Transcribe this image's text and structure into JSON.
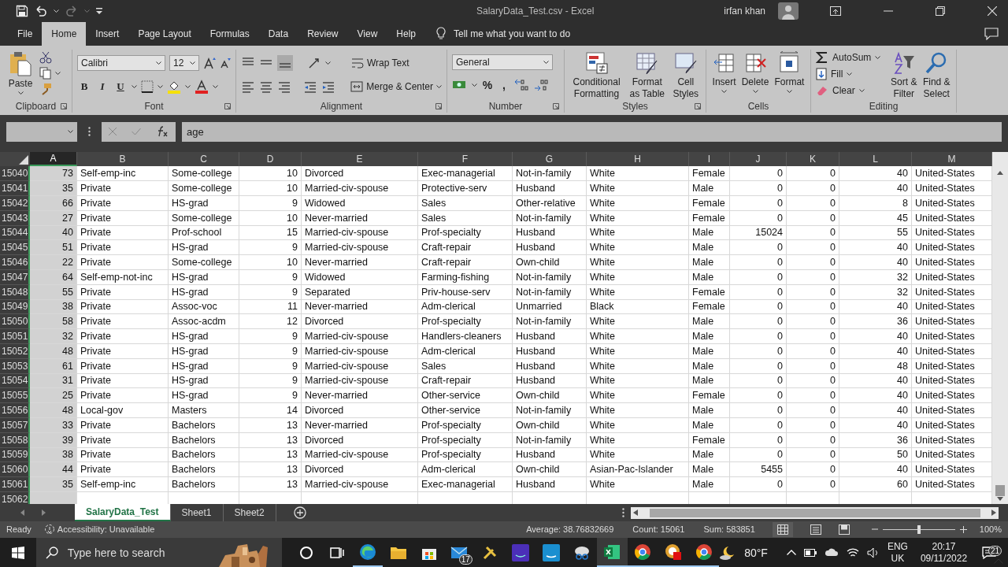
{
  "title_bar": {
    "title": "SalaryData_Test.csv  -  Excel",
    "user": "irfan khan",
    "redo": {
      "disabled": true
    }
  },
  "menu_tabs": [
    {
      "label": "File",
      "selected": false
    },
    {
      "label": "Home",
      "selected": true
    },
    {
      "label": "Insert",
      "selected": false
    },
    {
      "label": "Page Layout",
      "selected": false
    },
    {
      "label": "Formulas",
      "selected": false
    },
    {
      "label": "Data",
      "selected": false
    },
    {
      "label": "Review",
      "selected": false
    },
    {
      "label": "View",
      "selected": false
    },
    {
      "label": "Help",
      "selected": false
    }
  ],
  "tell_me": "Tell me what you want to do",
  "ribbon": {
    "clipboard": {
      "label": "Clipboard",
      "paste": "Paste"
    },
    "font": {
      "label": "Font",
      "name": "Calibri",
      "size": "12",
      "styles": [
        "B",
        "I",
        "U"
      ]
    },
    "alignment": {
      "label": "Alignment",
      "wrap": "Wrap Text",
      "merge": "Merge & Center"
    },
    "number": {
      "label": "Number",
      "format": "General",
      "symbols": [
        "%",
        ","
      ]
    },
    "styles": {
      "label": "Styles",
      "buttons": [
        "Conditional Formatting",
        "Format as Table",
        "Cell Styles"
      ]
    },
    "cells": {
      "label": "Cells",
      "buttons": [
        "Insert",
        "Delete",
        "Format"
      ]
    },
    "editing": {
      "label": "Editing",
      "small": [
        "AutoSum",
        "Fill",
        "Clear"
      ],
      "buttons": [
        "Sort & Filter",
        "Find & Select"
      ]
    }
  },
  "formula_bar": {
    "formula": "age"
  },
  "columns": [
    {
      "label": "A",
      "kind": "numeric",
      "selected": true
    },
    {
      "label": "B",
      "kind": "text",
      "selected": false
    },
    {
      "label": "C",
      "kind": "text",
      "selected": false
    },
    {
      "label": "D",
      "kind": "numeric",
      "selected": false
    },
    {
      "label": "E",
      "kind": "text",
      "selected": false
    },
    {
      "label": "F",
      "kind": "text",
      "selected": false
    },
    {
      "label": "G",
      "kind": "text",
      "selected": false
    },
    {
      "label": "H",
      "kind": "text",
      "selected": false
    },
    {
      "label": "I",
      "kind": "text",
      "selected": false
    },
    {
      "label": "J",
      "kind": "numeric",
      "selected": false
    },
    {
      "label": "K",
      "kind": "numeric",
      "selected": false
    },
    {
      "label": "L",
      "kind": "numeric",
      "selected": false
    },
    {
      "label": "M",
      "kind": "text",
      "selected": false
    }
  ],
  "rows": [
    {
      "number": "15040",
      "cells": [
        "73",
        "Self-emp-inc",
        "Some-college",
        "10",
        "Divorced",
        "Exec-managerial",
        "Not-in-family",
        "White",
        "Female",
        "0",
        "0",
        "40",
        "United-States"
      ]
    },
    {
      "number": "15041",
      "cells": [
        "35",
        "Private",
        "Some-college",
        "10",
        "Married-civ-spouse",
        "Protective-serv",
        "Husband",
        "White",
        "Male",
        "0",
        "0",
        "40",
        "United-States"
      ]
    },
    {
      "number": "15042",
      "cells": [
        "66",
        "Private",
        "HS-grad",
        "9",
        "Widowed",
        "Sales",
        "Other-relative",
        "White",
        "Female",
        "0",
        "0",
        "8",
        "United-States"
      ]
    },
    {
      "number": "15043",
      "cells": [
        "27",
        "Private",
        "Some-college",
        "10",
        "Never-married",
        "Sales",
        "Not-in-family",
        "White",
        "Female",
        "0",
        "0",
        "45",
        "United-States"
      ]
    },
    {
      "number": "15044",
      "cells": [
        "40",
        "Private",
        "Prof-school",
        "15",
        "Married-civ-spouse",
        "Prof-specialty",
        "Husband",
        "White",
        "Male",
        "15024",
        "0",
        "55",
        "United-States"
      ]
    },
    {
      "number": "15045",
      "cells": [
        "51",
        "Private",
        "HS-grad",
        "9",
        "Married-civ-spouse",
        "Craft-repair",
        "Husband",
        "White",
        "Male",
        "0",
        "0",
        "40",
        "United-States"
      ]
    },
    {
      "number": "15046",
      "cells": [
        "22",
        "Private",
        "Some-college",
        "10",
        "Never-married",
        "Craft-repair",
        "Own-child",
        "White",
        "Male",
        "0",
        "0",
        "40",
        "United-States"
      ]
    },
    {
      "number": "15047",
      "cells": [
        "64",
        "Self-emp-not-inc",
        "HS-grad",
        "9",
        "Widowed",
        "Farming-fishing",
        "Not-in-family",
        "White",
        "Male",
        "0",
        "0",
        "32",
        "United-States"
      ]
    },
    {
      "number": "15048",
      "cells": [
        "55",
        "Private",
        "HS-grad",
        "9",
        "Separated",
        "Priv-house-serv",
        "Not-in-family",
        "White",
        "Female",
        "0",
        "0",
        "32",
        "United-States"
      ]
    },
    {
      "number": "15049",
      "cells": [
        "38",
        "Private",
        "Assoc-voc",
        "11",
        "Never-married",
        "Adm-clerical",
        "Unmarried",
        "Black",
        "Female",
        "0",
        "0",
        "40",
        "United-States"
      ]
    },
    {
      "number": "15050",
      "cells": [
        "58",
        "Private",
        "Assoc-acdm",
        "12",
        "Divorced",
        "Prof-specialty",
        "Not-in-family",
        "White",
        "Male",
        "0",
        "0",
        "36",
        "United-States"
      ]
    },
    {
      "number": "15051",
      "cells": [
        "32",
        "Private",
        "HS-grad",
        "9",
        "Married-civ-spouse",
        "Handlers-cleaners",
        "Husband",
        "White",
        "Male",
        "0",
        "0",
        "40",
        "United-States"
      ]
    },
    {
      "number": "15052",
      "cells": [
        "48",
        "Private",
        "HS-grad",
        "9",
        "Married-civ-spouse",
        "Adm-clerical",
        "Husband",
        "White",
        "Male",
        "0",
        "0",
        "40",
        "United-States"
      ]
    },
    {
      "number": "15053",
      "cells": [
        "61",
        "Private",
        "HS-grad",
        "9",
        "Married-civ-spouse",
        "Sales",
        "Husband",
        "White",
        "Male",
        "0",
        "0",
        "48",
        "United-States"
      ]
    },
    {
      "number": "15054",
      "cells": [
        "31",
        "Private",
        "HS-grad",
        "9",
        "Married-civ-spouse",
        "Craft-repair",
        "Husband",
        "White",
        "Male",
        "0",
        "0",
        "40",
        "United-States"
      ]
    },
    {
      "number": "15055",
      "cells": [
        "25",
        "Private",
        "HS-grad",
        "9",
        "Never-married",
        "Other-service",
        "Own-child",
        "White",
        "Female",
        "0",
        "0",
        "40",
        "United-States"
      ]
    },
    {
      "number": "15056",
      "cells": [
        "48",
        "Local-gov",
        "Masters",
        "14",
        "Divorced",
        "Other-service",
        "Not-in-family",
        "White",
        "Male",
        "0",
        "0",
        "40",
        "United-States"
      ]
    },
    {
      "number": "15057",
      "cells": [
        "33",
        "Private",
        "Bachelors",
        "13",
        "Never-married",
        "Prof-specialty",
        "Own-child",
        "White",
        "Male",
        "0",
        "0",
        "40",
        "United-States"
      ]
    },
    {
      "number": "15058",
      "cells": [
        "39",
        "Private",
        "Bachelors",
        "13",
        "Divorced",
        "Prof-specialty",
        "Not-in-family",
        "White",
        "Female",
        "0",
        "0",
        "36",
        "United-States"
      ]
    },
    {
      "number": "15059",
      "cells": [
        "38",
        "Private",
        "Bachelors",
        "13",
        "Married-civ-spouse",
        "Prof-specialty",
        "Husband",
        "White",
        "Male",
        "0",
        "0",
        "50",
        "United-States"
      ]
    },
    {
      "number": "15060",
      "cells": [
        "44",
        "Private",
        "Bachelors",
        "13",
        "Divorced",
        "Adm-clerical",
        "Own-child",
        "Asian-Pac-Islander",
        "Male",
        "5455",
        "0",
        "40",
        "United-States"
      ]
    },
    {
      "number": "15061",
      "cells": [
        "35",
        "Self-emp-inc",
        "Bachelors",
        "13",
        "Married-civ-spouse",
        "Exec-managerial",
        "Husband",
        "White",
        "Male",
        "0",
        "0",
        "60",
        "United-States"
      ]
    },
    {
      "number": "15062"
    }
  ],
  "sheet_tabs": [
    {
      "label": "SalaryData_Test",
      "selected": true
    },
    {
      "label": "Sheet1",
      "selected": false
    },
    {
      "label": "Sheet2",
      "selected": false
    }
  ],
  "status_bar": {
    "mode": "Ready",
    "accessibility": "Accessibility: Unavailable",
    "average": "Average: 38.76832669",
    "count": "Count: 15061",
    "sum": "Sum: 583851",
    "zoom": "100%",
    "zoom_level": {
      "level": 0.5
    }
  },
  "taskbar": {
    "search_placeholder": "Type here to search",
    "apps": [
      {
        "kind": "cortana",
        "running": false,
        "active": false
      },
      {
        "kind": "taskview",
        "running": false,
        "active": false
      },
      {
        "kind": "edge",
        "running": true,
        "active": false
      },
      {
        "kind": "explorer",
        "running": false,
        "active": false
      },
      {
        "kind": "store",
        "running": false,
        "active": false
      },
      {
        "kind": "mail",
        "running": false,
        "active": false,
        "badge": "17"
      },
      {
        "kind": "tools",
        "running": false,
        "active": false
      },
      {
        "kind": "music",
        "running": false,
        "active": false
      },
      {
        "kind": "video",
        "running": false,
        "active": false
      },
      {
        "kind": "snip",
        "running": false,
        "active": false
      },
      {
        "kind": "excel",
        "running": true,
        "active": true
      },
      {
        "kind": "chrome",
        "running": true,
        "active": false
      },
      {
        "kind": "recorder",
        "running": true,
        "active": false
      },
      {
        "kind": "chrome",
        "running": true,
        "active": false
      }
    ],
    "weather": "80°F",
    "language": "ENG",
    "region": "UK",
    "time": "20:17",
    "date": "09/11/2022",
    "notifications": "21"
  }
}
